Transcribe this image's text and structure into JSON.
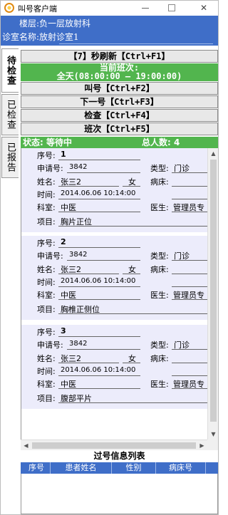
{
  "window": {
    "title": "叫号客户端",
    "min_glyph": "—",
    "max_glyph": "☐",
    "close_glyph": "✕"
  },
  "info": {
    "floor_label": "楼层:",
    "floor_value": "负一层放射科",
    "room_label": "诊室名称:",
    "room_value": "放射诊室1"
  },
  "tabs": [
    {
      "label": "待检查"
    },
    {
      "label": "已检查"
    },
    {
      "label": "已报告"
    }
  ],
  "controls": {
    "refresh": "【7】秒刷新【Ctrl+F1】",
    "shift_line1": "当前班次:",
    "shift_line2": "全天(08:00:00 — 19:00:00)",
    "call": "叫号【Ctrl+F2】",
    "next": "下一号【Ctrl+F3】",
    "check": "检查【Ctrl+F4】",
    "shift": "班次【Ctrl+F5】"
  },
  "status": {
    "state": "状态: 等待中",
    "total": "总人数: 4"
  },
  "labels": {
    "seq": "序号:",
    "request": "申请号:",
    "type": "类型:",
    "name": "姓名:",
    "bed": "病床:",
    "time": "时间:",
    "dept": "科室:",
    "doctor": "医生:",
    "item": "项目:"
  },
  "patients": [
    {
      "seq": "1",
      "request": "3842",
      "type": "门诊",
      "name": "张三2",
      "gender": "女",
      "bed": "",
      "time": "2014.06.06 10:14:00",
      "dept": "中医",
      "doctor": "管理员专",
      "item": "胸片正位"
    },
    {
      "seq": "2",
      "request": "3842",
      "type": "门诊",
      "name": "张三2",
      "gender": "女",
      "bed": "",
      "time": "2014.06.06 10:14:00",
      "dept": "中医",
      "doctor": "管理员专",
      "item": "胸椎正侧位"
    },
    {
      "seq": "3",
      "request": "3842",
      "type": "门诊",
      "name": "张三2",
      "gender": "女",
      "bed": "",
      "time": "2014.06.06 10:14:00",
      "dept": "中医",
      "doctor": "管理员专",
      "item": "腹部平片"
    }
  ],
  "passed": {
    "title": "过号信息列表",
    "columns": [
      "序号",
      "患者姓名",
      "性别",
      "病床号"
    ]
  }
}
